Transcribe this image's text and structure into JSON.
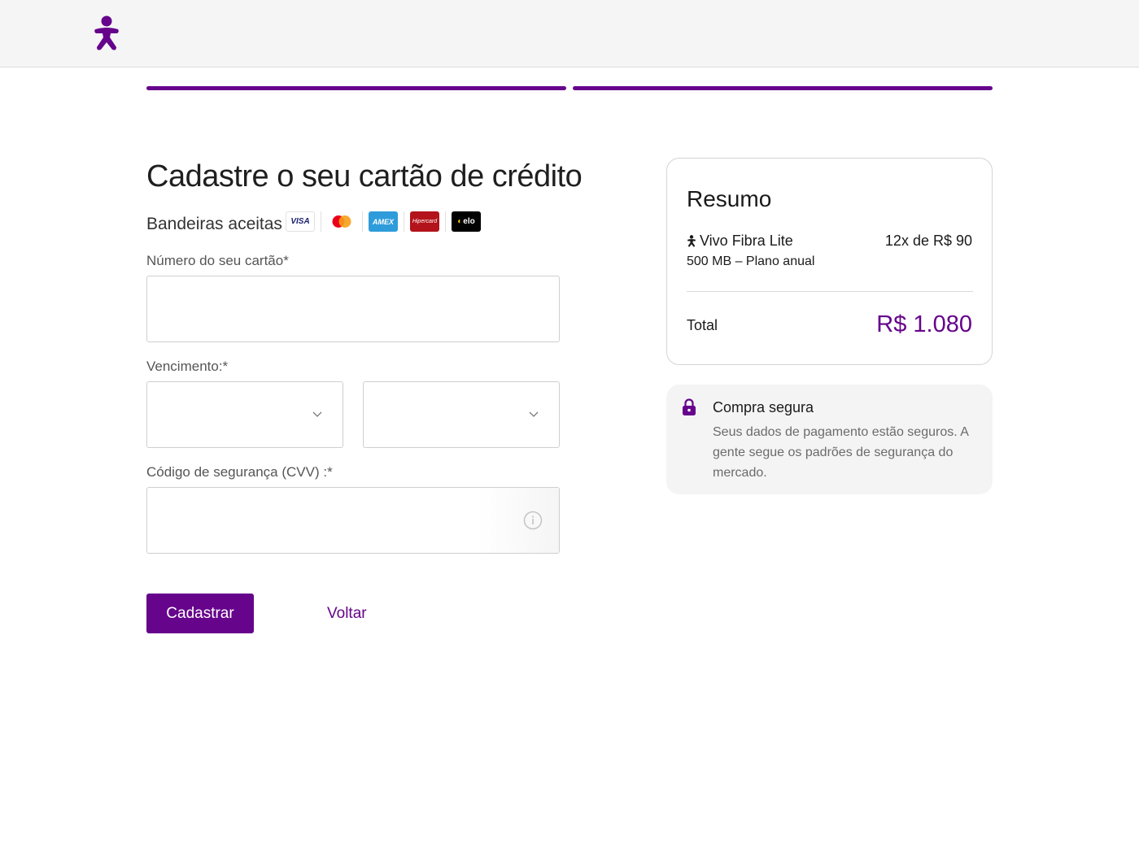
{
  "colors": {
    "brand": "#66048c",
    "header_bg": "#f5f5f5",
    "muted_text": "#6b6b6b"
  },
  "header": {
    "logo_icon": "vivo-person-logo-icon"
  },
  "progress": {
    "steps": 2,
    "completed": 2
  },
  "form": {
    "title": "Cadastre o seu cartão de crédito",
    "brands_label": "Bandeiras aceitas",
    "brands": [
      "VISA",
      "mastercard",
      "AMEX",
      "Hipercard",
      "elo"
    ],
    "card_number": {
      "label": "Número do seu cartão*",
      "value": ""
    },
    "expiry": {
      "label": "Vencimento:*",
      "month_value": "",
      "year_value": ""
    },
    "cvv": {
      "label": "Código de segurança (CVV) :*",
      "value": "",
      "info_icon": "info-icon"
    },
    "submit_label": "Cadastrar",
    "back_label": "Voltar"
  },
  "summary": {
    "title": "Resumo",
    "plan_name": "Vivo Fibra Lite",
    "plan_price": "12x de R$ 90",
    "plan_detail": "500 MB – Plano anual",
    "total_label": "Total",
    "total_value": "R$ 1.080"
  },
  "secure": {
    "icon": "lock-icon",
    "title": "Compra segura",
    "text": "Seus dados de pagamento estão seguros. A gente segue os padrões de segurança do mercado."
  }
}
